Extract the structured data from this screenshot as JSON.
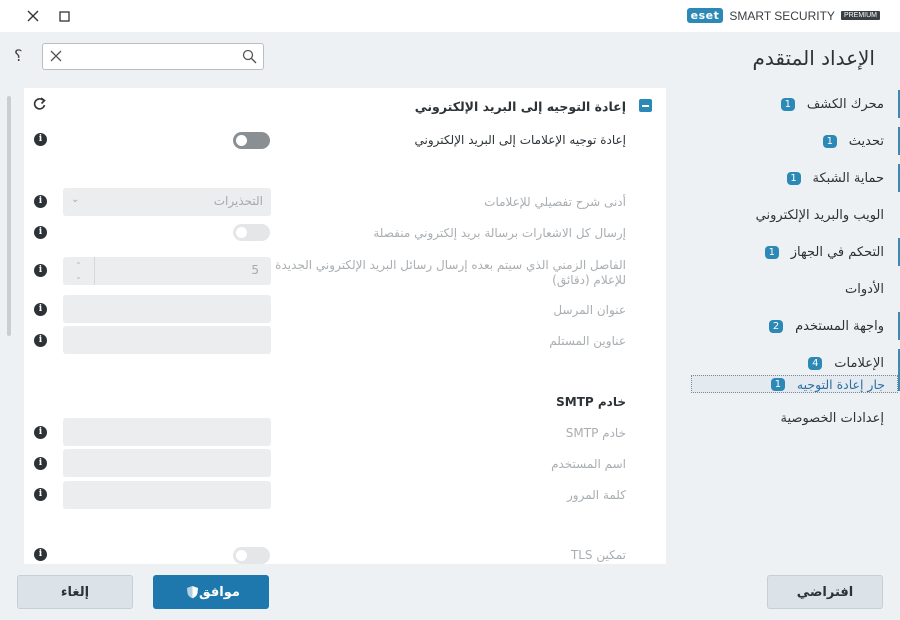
{
  "brand": {
    "logo": "eset",
    "name": "SMART SECURITY",
    "edition": "PREMIUM"
  },
  "page": {
    "title": "الإعداد المتقدم",
    "help": "؟"
  },
  "search": {
    "placeholder": ""
  },
  "nav": {
    "items": [
      {
        "label": "محرك الكشف",
        "badge": "1"
      },
      {
        "label": "تحديث",
        "badge": "1"
      },
      {
        "label": "حماية الشبكة",
        "badge": "1"
      },
      {
        "label": "الويب والبريد الإلكتروني",
        "badge": ""
      },
      {
        "label": "التحكم في الجهاز",
        "badge": "1"
      },
      {
        "label": "الأدوات",
        "badge": ""
      },
      {
        "label": "واجهة المستخدم",
        "badge": "2"
      },
      {
        "label": "الإعلامات",
        "badge": "4"
      }
    ],
    "sub_item": {
      "label": "جار إعادة التوجيه",
      "badge": "1"
    },
    "privacy": "إعدادات الخصوصية"
  },
  "section": {
    "title": "إعادة التوجيه إلى البريد الإلكتروني",
    "rows": {
      "forward": "إعادة توجيه الإعلامات إلى البريد الإلكتروني",
      "verbosity": "أدنى شرح تفصيلي للإعلامات",
      "verbosity_value": "التحذيرات",
      "separate": "إرسال كل الاشعارات برسالة بريد إلكتروني منفصلة",
      "interval_line1": "الفاصل الزمني الذي سيتم بعده إرسال رسائل البريد الإلكتروني الجديدة",
      "interval_line2": "للإعلام (دقائق)",
      "interval_value": "5",
      "sender": "عنوان المرسل",
      "recipients": "عناوين المستلم",
      "smtp_heading": "خادم SMTP",
      "smtp_server": "خادم SMTP",
      "username": "اسم المستخدم",
      "password": "كلمة المرور",
      "tls": "تمكين TLS"
    }
  },
  "buttons": {
    "default": "افتراضي",
    "ok": "موافق",
    "cancel": "إلغاء"
  }
}
